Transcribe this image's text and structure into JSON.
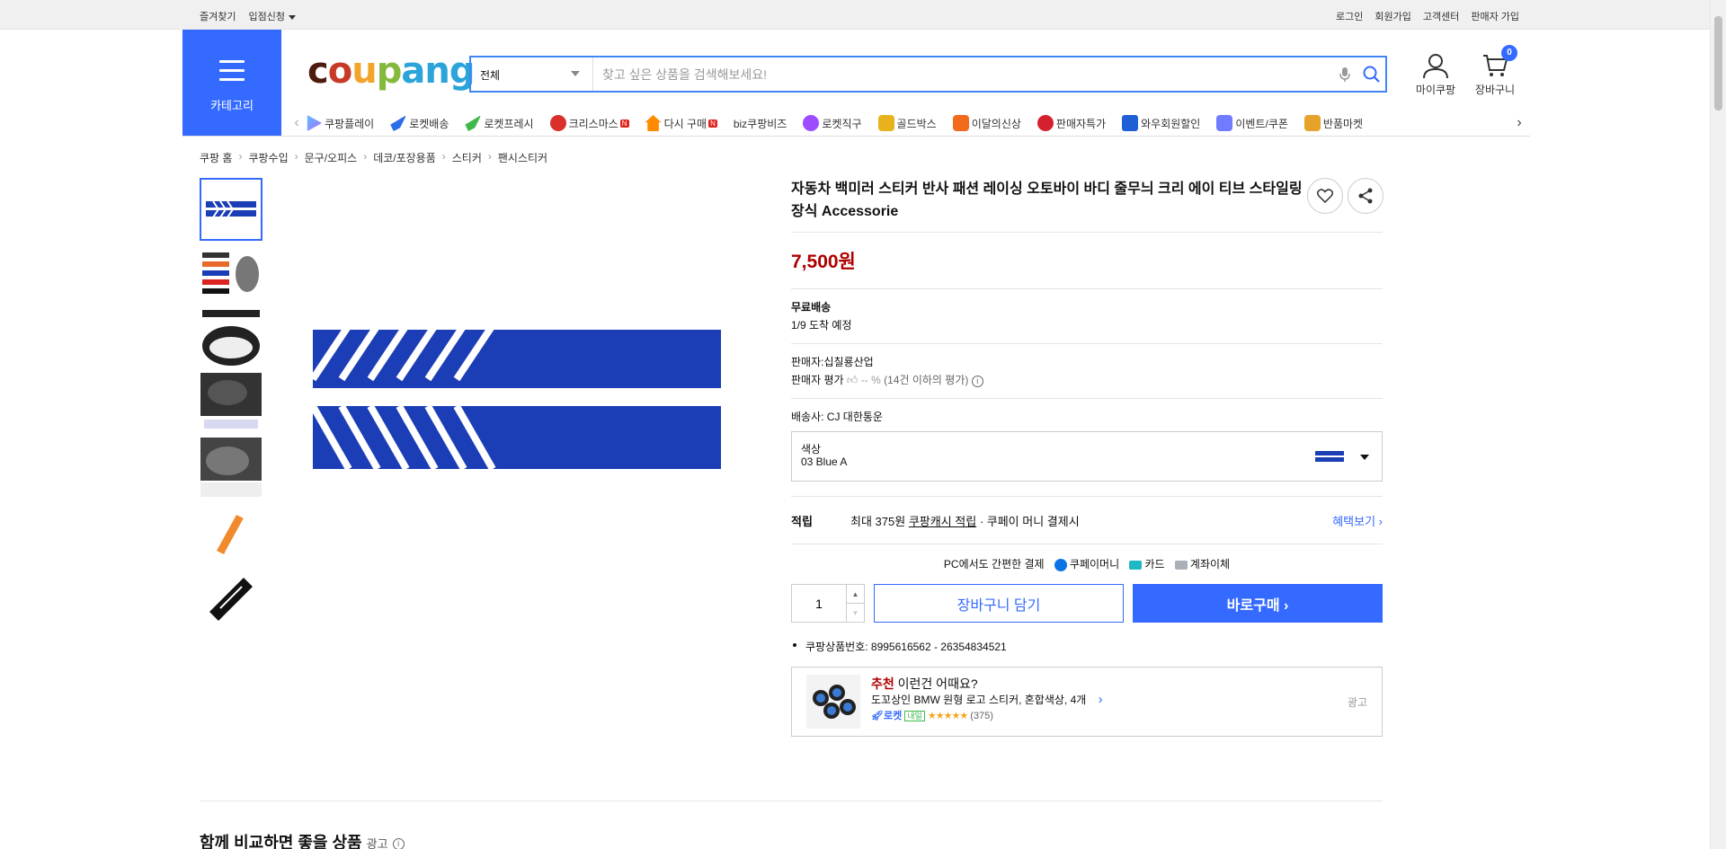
{
  "topbar": {
    "left": [
      "즐겨찾기",
      "입점신청"
    ],
    "right": [
      "로그인",
      "회원가입",
      "고객센터",
      "판매자 가입"
    ]
  },
  "header": {
    "category_label": "카테고리",
    "logo": "coupang",
    "search": {
      "scope": "전체",
      "placeholder": "찾고 싶은 상품을 검색해보세요!"
    },
    "mypage_label": "마이쿠팡",
    "cart_label": "장바구니",
    "cart_count": "0"
  },
  "nav": [
    "쿠팡플레이",
    "로켓배송",
    "로켓프레시",
    "크리스마스",
    "다시 구매",
    "biz쿠팡비즈",
    "로켓직구",
    "골드박스",
    "이달의신상",
    "판매자특가",
    "와우회원할인",
    "이벤트/쿠폰",
    "반품마켓"
  ],
  "breadcrumb": [
    "쿠팡 홈",
    "쿠팡수입",
    "문구/오피스",
    "데코/포장용품",
    "스티커",
    "팬시스티커"
  ],
  "product": {
    "title": "자동차 백미러 스티커 반사 패션 레이싱 오토바이 바디 줄무늬 크리 에이 티브 스타일링 장식 Accessorie",
    "price": "7,500원",
    "shipping_label": "무료배송",
    "arrival": "1/9 도착 예정",
    "seller": "판매자:십칠룡산업",
    "seller_rating": "판매자 평가",
    "seller_rating_value": "-- %",
    "seller_rating_note": "(14건 이하의 평가)",
    "courier": "배송사:  CJ 대한통운",
    "option_label": "색상",
    "option_value": "03 Blue A",
    "reward_key": "적립",
    "reward_text": "최대 375원",
    "reward_link_text": "쿠팡캐시 적립",
    "reward_suffix": "· 쿠페이 머니 결제시",
    "benefit_link": "혜택보기",
    "pay_label": "PC에서도 간편한 결제",
    "pay_methods": [
      "쿠페이머니",
      "카드",
      "계좌이체"
    ],
    "quantity": "1",
    "cart_button": "장바구니 담기",
    "buy_button": "바로구매",
    "product_id": "쿠팡상품번호: 8995616562 - 26354834521"
  },
  "recommend": {
    "head_accent": "추천",
    "head_rest": " 이런건 어때요?",
    "item": "도꼬상인 BMW 원형 로고 스티커, 혼합색상, 4개",
    "rocket": "로켓",
    "tomorrow": "내일",
    "stars": "★★★★★",
    "reviews": "(375)",
    "ad": "광고",
    "rating": 4.5
  },
  "section": {
    "title": "함께 비교하면 좋을 상품",
    "ad": "광고"
  },
  "colors": {
    "accent": "#346aff",
    "price": "#ae0000",
    "sticker": "#1b3db5"
  }
}
